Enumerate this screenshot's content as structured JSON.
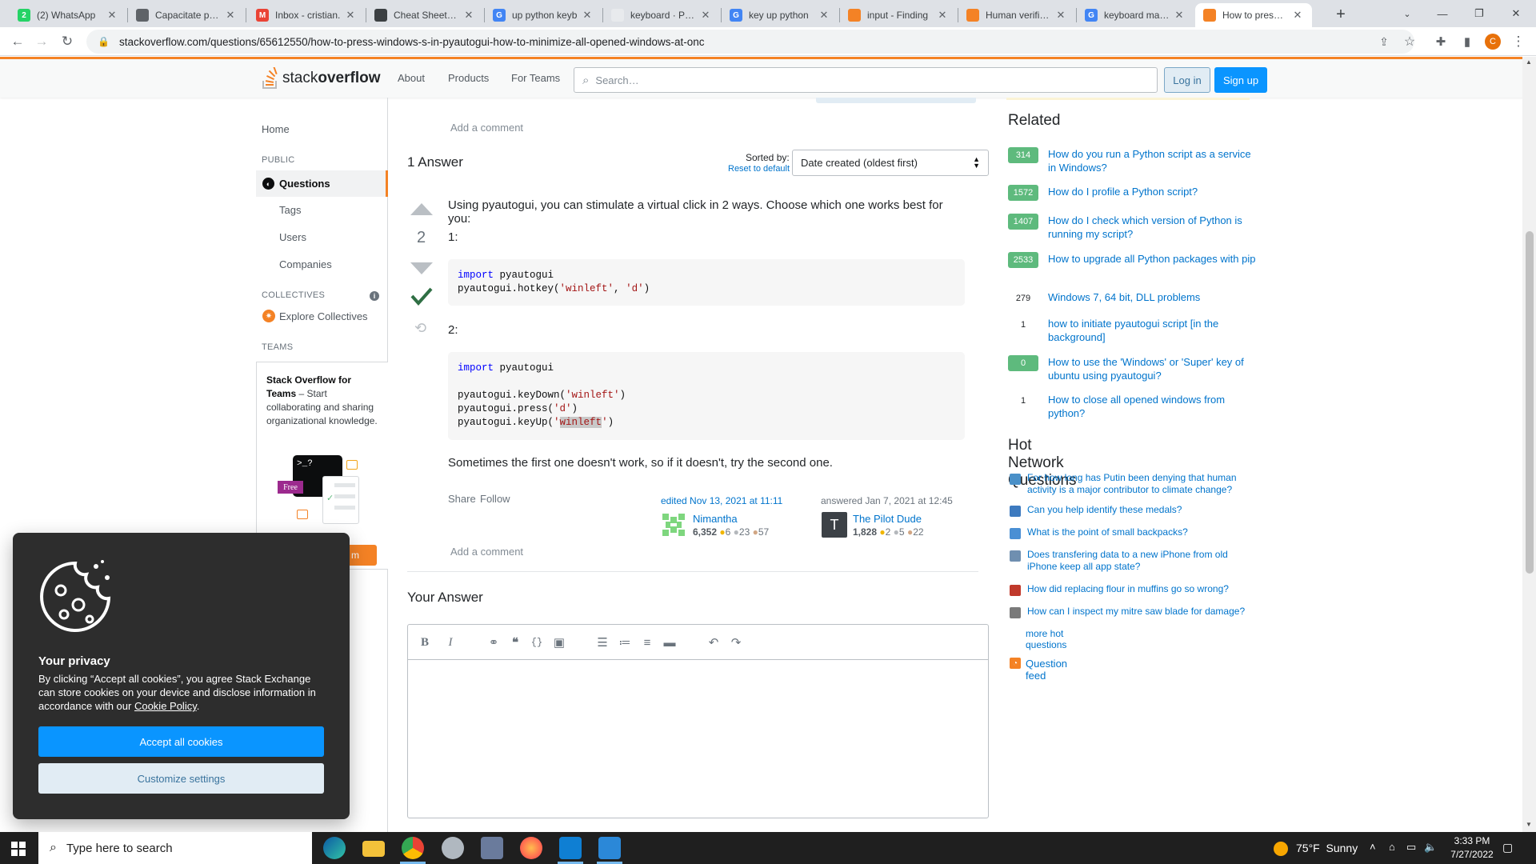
{
  "browser": {
    "tabs": [
      {
        "label": "(2) WhatsApp",
        "fav": "whatsapp-icon",
        "color": "#25d366",
        "glyph": "2"
      },
      {
        "label": "Capacitate para",
        "fav": "doc-icon",
        "color": "#5f6368",
        "glyph": ""
      },
      {
        "label": "Inbox - cristian.",
        "fav": "gmail-icon",
        "color": "#ea4335",
        "glyph": "M"
      },
      {
        "label": "Cheat Sheet — ",
        "fav": "doc-icon",
        "color": "#3c4043",
        "glyph": ""
      },
      {
        "label": "up python keyb",
        "fav": "google-icon",
        "color": "#4285f4",
        "glyph": "G"
      },
      {
        "label": "keyboard · PyPI",
        "fav": "pypi-icon",
        "color": "#e8eaed",
        "glyph": ""
      },
      {
        "label": "key up python",
        "fav": "google-icon",
        "color": "#4285f4",
        "glyph": "G"
      },
      {
        "label": "input - Finding",
        "fav": "stackoverflow-icon",
        "color": "#f48225",
        "glyph": ""
      },
      {
        "label": "Human verificat",
        "fav": "stackoverflow-icon",
        "color": "#f48225",
        "glyph": ""
      },
      {
        "label": "keyboard maxim",
        "fav": "google-icon",
        "color": "#4285f4",
        "glyph": "G"
      },
      {
        "label": "How to press W",
        "fav": "stackoverflow-icon",
        "color": "#f48225",
        "glyph": ""
      }
    ],
    "new_tab": "+",
    "url": "stackoverflow.com/questions/65612550/how-to-press-windows-s-in-pyautogui-how-to-minimize-all-opened-windows-at-onc",
    "profile_initial": "C"
  },
  "so_header": {
    "logo_light": "stack",
    "logo_bold": "overflow",
    "nav": [
      "About",
      "Products",
      "For Teams"
    ],
    "search_placeholder": "Search…",
    "login": "Log in",
    "signup": "Sign up"
  },
  "leftnav": {
    "home": "Home",
    "public": "PUBLIC",
    "questions": "Questions",
    "tags": "Tags",
    "users": "Users",
    "companies": "Companies",
    "collectives": "COLLECTIVES",
    "explore": "Explore Collectives",
    "teams": "TEAMS",
    "teams_title": "Stack Overflow for Teams",
    "teams_body": " – Start collaborating and sharing organizational knowledge.",
    "free": "Free",
    "teams_btn_visible": "m"
  },
  "question": {
    "add_comment_top": "Add a comment",
    "answers_count": "1 Answer",
    "sorted_by": "Sorted by:",
    "reset": "Reset to default",
    "sort_value": "Date created (oldest first)"
  },
  "answer": {
    "score": "2",
    "intro": "Using pyautogui, you can stimulate a virtual click in 2 ways. Choose which one works best for you:",
    "label1": "1:",
    "label2": "2:",
    "outro": "Sometimes the first one doesn't work, so if it doesn't, try the second one.",
    "share": "Share",
    "follow": "Follow",
    "edited": "edited Nov 13, 2021 at 11:11",
    "editor_name": "Nimantha",
    "editor_rep": "6,352",
    "editor_gold": "6",
    "editor_silver": "23",
    "editor_bronze": "57",
    "answered": "answered Jan 7, 2021 at 12:45",
    "author_initial": "T",
    "author_name": "The Pilot Dude",
    "author_rep": "1,828",
    "author_gold": "2",
    "author_silver": "5",
    "author_bronze": "22",
    "add_comment": "Add a comment"
  },
  "your_answer": {
    "title": "Your Answer"
  },
  "related": {
    "title": "Related",
    "items": [
      {
        "count": "314",
        "answered": true,
        "text": "How do you run a Python script as a service in Windows?"
      },
      {
        "count": "1572",
        "answered": true,
        "text": "How do I profile a Python script?"
      },
      {
        "count": "1407",
        "answered": true,
        "text": "How do I check which version of Python is running my script?"
      },
      {
        "count": "2533",
        "answered": true,
        "text": "How to upgrade all Python packages with pip"
      },
      {
        "count": "279",
        "answered": false,
        "text": "Windows 7, 64 bit, DLL problems"
      },
      {
        "count": "1",
        "answered": false,
        "text": "how to initiate pyautogui script [in the background]"
      },
      {
        "count": "0",
        "answered": true,
        "text": "How to use the 'Windows' or 'Super' key of ubuntu using pyautogui?"
      },
      {
        "count": "1",
        "answered": false,
        "text": "How to close all opened windows from python?"
      }
    ]
  },
  "hot": {
    "title": "Hot Network Questions",
    "items": [
      {
        "text": "For how long has Putin been denying that human activity is a major contributor to climate change?",
        "color": "#4a90c8",
        "icon": "politics-icon"
      },
      {
        "text": "Can you help identify these medals?",
        "color": "#3d7abf",
        "icon": "history-icon"
      },
      {
        "text": "What is the point of small backpacks?",
        "color": "#4a8fd4",
        "icon": "outdoors-icon"
      },
      {
        "text": "Does transfering data to a new iPhone from old iPhone keep all app state?",
        "color": "#6f8fb0",
        "icon": "apple-icon"
      },
      {
        "text": "How did replacing flour in muffins go so wrong?",
        "color": "#c0392b",
        "icon": "cooking-icon"
      },
      {
        "text": "How can I inspect my mitre saw blade for damage?",
        "color": "#7a7a7a",
        "icon": "diy-icon"
      }
    ],
    "more": "more hot questions",
    "feed": "Question feed"
  },
  "cookie": {
    "title": "Your privacy",
    "body": "By clicking “Accept all cookies”, you agree Stack Exchange can store cookies on your device and disclose information in accordance with our ",
    "policy": "Cookie Policy",
    "accept": "Accept all cookies",
    "customize": "Customize settings"
  },
  "taskbar": {
    "search": "Type here to search",
    "weather": "75°F  Sunny",
    "time": "3:33 PM",
    "date": "7/27/2022"
  }
}
